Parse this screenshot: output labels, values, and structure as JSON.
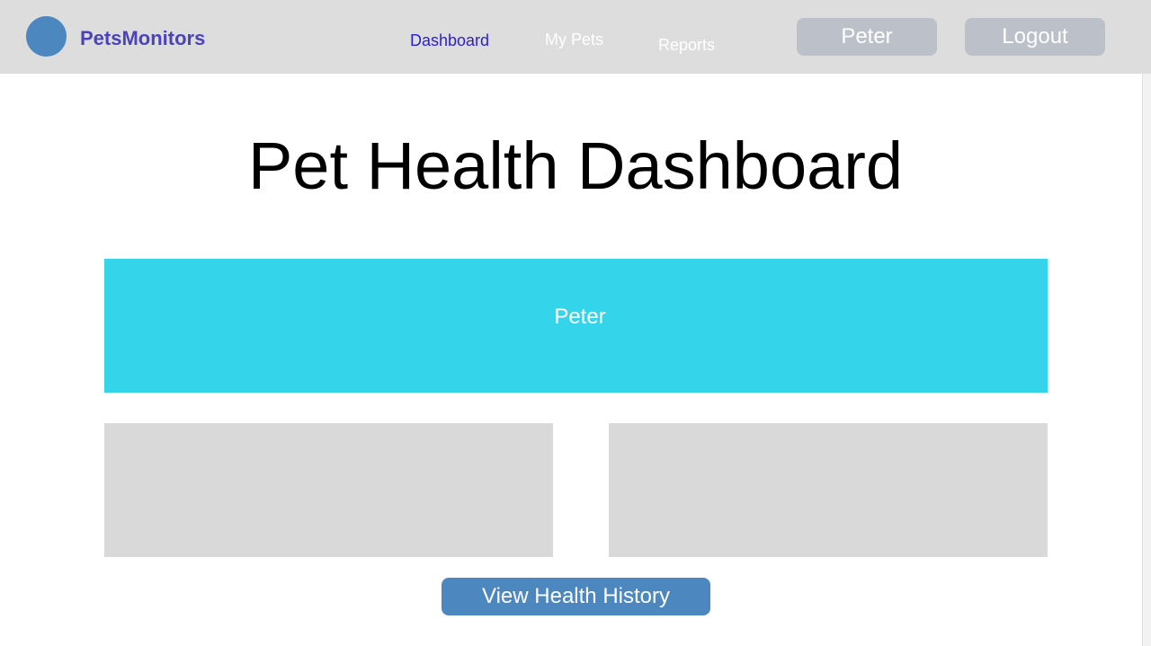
{
  "header": {
    "brand": "PetsMonitors",
    "logo_icon": "circle-logo-icon",
    "nav": [
      {
        "label": "Dashboard",
        "active": true
      },
      {
        "label": "My Pets",
        "active": false
      },
      {
        "label": "Reports",
        "active": false
      }
    ],
    "user_button": "Peter",
    "logout_button": "Logout"
  },
  "main": {
    "title": "Pet Health Dashboard",
    "banner_label": "Peter",
    "history_button": "View Health History"
  },
  "colors": {
    "header_bg": "#dddddd",
    "logo": "#4d87c0",
    "brand": "#4b43bb",
    "nav_active": "#2a1fd0",
    "nav_inactive": "#ffffff",
    "header_button": "#bcc1c9",
    "banner": "#34d5ea",
    "panel": "#d9d9d9",
    "primary_button": "#4d87c0",
    "button_text": "#ffffff"
  }
}
